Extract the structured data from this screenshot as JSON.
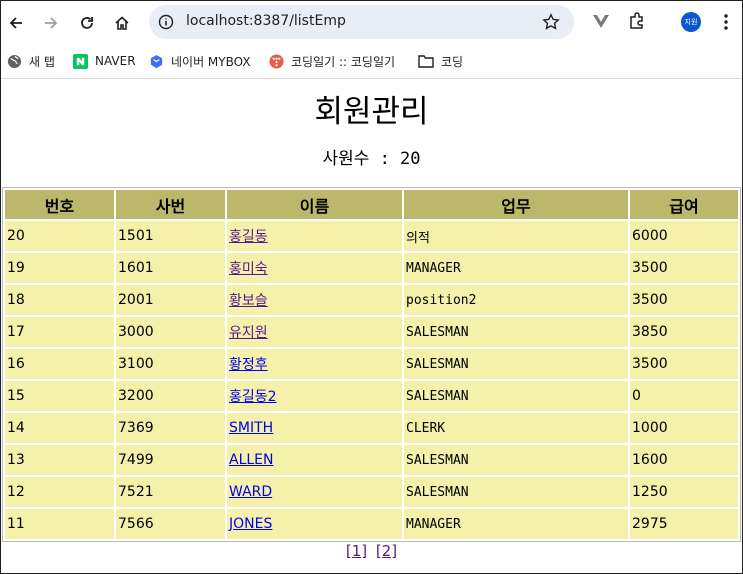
{
  "browser": {
    "url": "localhost:8387/listEmp",
    "profile_label": "지원",
    "bookmarks": [
      {
        "label": "새 탭"
      },
      {
        "label": "NAVER"
      },
      {
        "label": "네이버 MYBOX"
      },
      {
        "label": "코딩일기 :: 코딩일기"
      },
      {
        "label": "코딩"
      }
    ]
  },
  "page": {
    "title": "회원관리",
    "count_label": "사원수 : 20"
  },
  "table": {
    "headers": [
      "번호",
      "사번",
      "이름",
      "업무",
      "급여"
    ],
    "rows": [
      {
        "no": "20",
        "empno": "1501",
        "name": "홍길동",
        "job": "의적",
        "sal": "6000"
      },
      {
        "no": "19",
        "empno": "1601",
        "name": "홍미숙",
        "job": "MANAGER",
        "sal": "3500"
      },
      {
        "no": "18",
        "empno": "2001",
        "name": "황보슬",
        "job": "position2",
        "sal": "3500"
      },
      {
        "no": "17",
        "empno": "3000",
        "name": "유지원",
        "job": "SALESMAN",
        "sal": "3850"
      },
      {
        "no": "16",
        "empno": "3100",
        "name": "황정후",
        "job": "SALESMAN",
        "sal": "3500"
      },
      {
        "no": "15",
        "empno": "3200",
        "name": "홍길동2",
        "job": "SALESMAN",
        "sal": "0"
      },
      {
        "no": "14",
        "empno": "7369",
        "name": "SMITH",
        "job": "CLERK",
        "sal": "1000"
      },
      {
        "no": "13",
        "empno": "7499",
        "name": "ALLEN",
        "job": "SALESMAN",
        "sal": "1600"
      },
      {
        "no": "12",
        "empno": "7521",
        "name": "WARD",
        "job": "SALESMAN",
        "sal": "1250"
      },
      {
        "no": "11",
        "empno": "7566",
        "name": "JONES",
        "job": "MANAGER",
        "sal": "2975"
      }
    ]
  },
  "pagination": {
    "pages": [
      "[1]",
      "[2]"
    ]
  },
  "colors": {
    "header_bg": "#bdb76b",
    "cell_bg": "#f5f0aa",
    "visited_link": "#551a8b",
    "link": "#0000ee"
  }
}
